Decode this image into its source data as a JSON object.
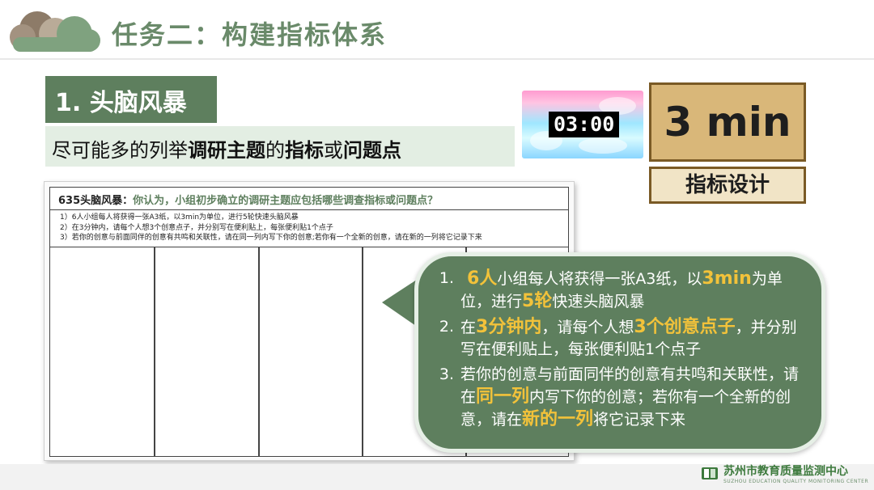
{
  "header": {
    "title": "任务二：构建指标体系",
    "logo_icon": "cloud-icon"
  },
  "section": {
    "badge": "1. 头脑风暴"
  },
  "instruction": {
    "p1": "尽可能多的列举",
    "b1": "调研主题",
    "p2": "的",
    "b2": "指标",
    "p3": "或",
    "b3": "问题点"
  },
  "timer": {
    "display": "03:00"
  },
  "duration": {
    "value": "3 min",
    "label": "指标设计"
  },
  "worksheet": {
    "title_prefix": "635头脑风暴：",
    "question": "你认为，小组初步确立的调研主题应包括哪些调查指标或问题点？",
    "rules": [
      "1）6人小组每人将获得一张A3纸，以3min为单位，进行5轮快速头脑风暴",
      "2）在3分钟内，请每个人想3个创意点子，并分别写在便利贴上，每张便利贴1个点子",
      "3）若你的创意与前面同伴的创意有共鸣和关联性，请在同一列内写下你的创意;若你有一个全新的创意，请在新的一列将它记录下来"
    ],
    "columns": 5
  },
  "callout": {
    "items": [
      {
        "num": "1.",
        "t1": "",
        "h1": "6人",
        "t2": "小组每人将获得一张A3纸，以",
        "h2": "3min",
        "t3": "为单位，进行",
        "h3": "5轮",
        "t4": "快速头脑风暴"
      },
      {
        "num": "2.",
        "t1": "在",
        "h1": "3分钟内",
        "t2": "，请每个人想",
        "h2": "3个创意点子",
        "t3": "，并分别写在便利贴上，每张便利贴1个点子",
        "h3": "",
        "t4": ""
      },
      {
        "num": "3.",
        "t1": "若你的创意与前面同伴的创意有共鸣和关联性，请在",
        "h1": "同一列",
        "t2": "内写下你的创意；若你有一个全新的创意，请在",
        "h2": "新的一列",
        "t3": "将它记录下来",
        "h3": "",
        "t4": ""
      }
    ]
  },
  "footer": {
    "org_cn": "苏州市教育质量监测中心",
    "org_en": "SUZHOU EDUCATION QUALITY MONITORING CENTER",
    "logo_icon": "book-logo-icon"
  },
  "colors": {
    "primary_green": "#5e7f5e",
    "light_green": "#e3eee3",
    "highlight_gold": "#f2c23a",
    "tan": "#d9b779"
  }
}
